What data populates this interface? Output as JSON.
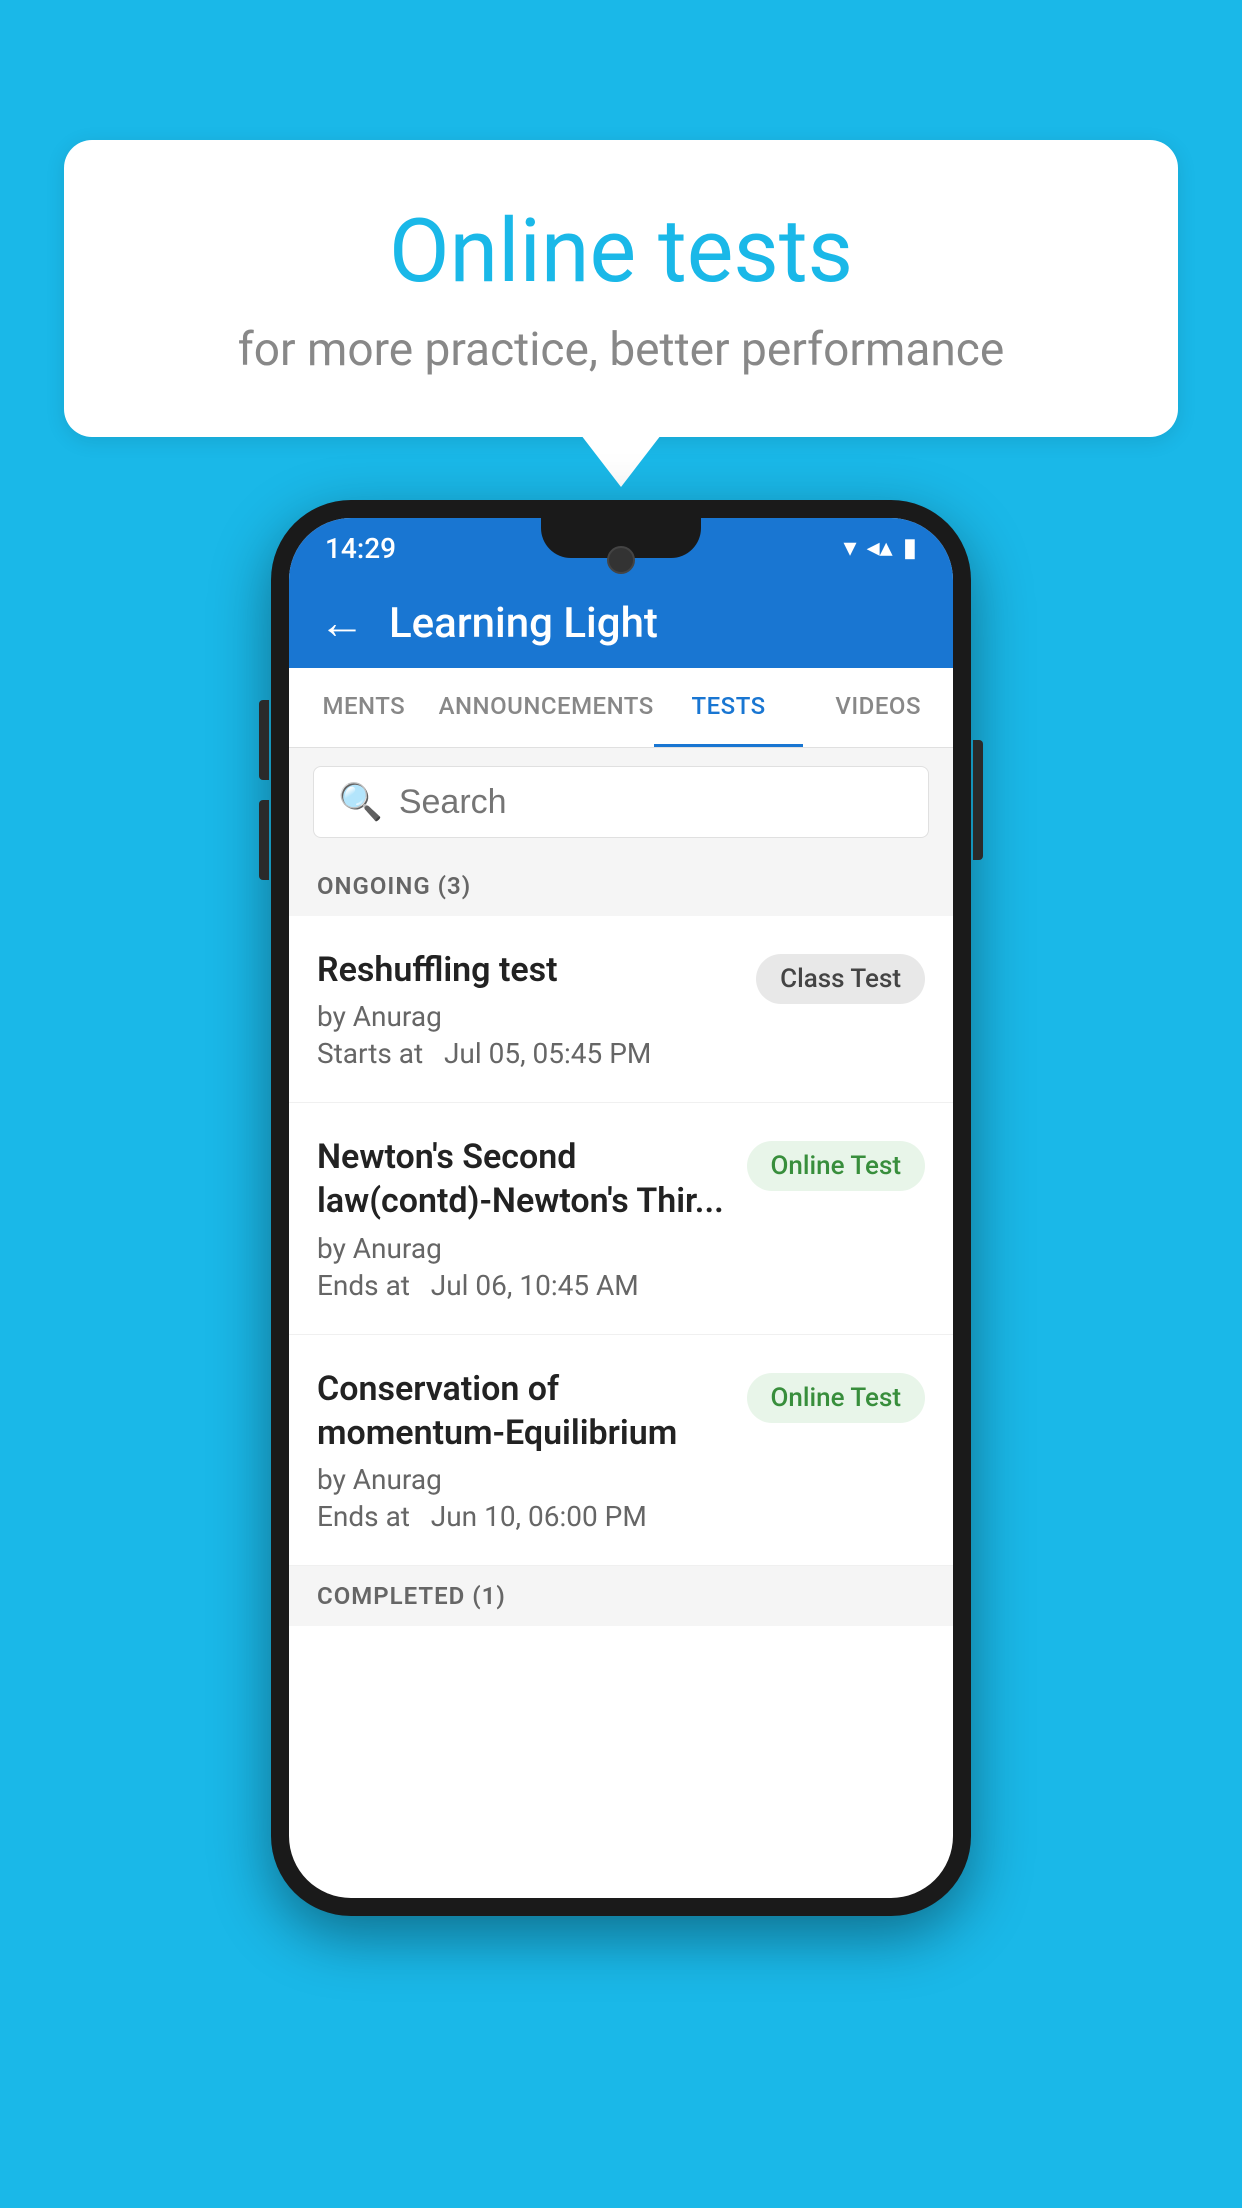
{
  "background_color": "#1ab8e8",
  "speech_bubble": {
    "title": "Online tests",
    "subtitle": "for more practice, better performance"
  },
  "phone": {
    "status_bar": {
      "time": "14:29",
      "wifi": "▾",
      "signal": "◂",
      "battery": "▮"
    },
    "header": {
      "back_label": "←",
      "title": "Learning Light"
    },
    "tabs": [
      {
        "label": "MENTS",
        "active": false
      },
      {
        "label": "ANNOUNCEMENTS",
        "active": false
      },
      {
        "label": "TESTS",
        "active": true
      },
      {
        "label": "VIDEOS",
        "active": false
      }
    ],
    "search": {
      "placeholder": "Search"
    },
    "ongoing_section": {
      "label": "ONGOING (3)"
    },
    "test_items": [
      {
        "name": "Reshuffling test",
        "author": "by Anurag",
        "time_label": "Starts at",
        "time_value": "Jul 05, 05:45 PM",
        "badge": "Class Test",
        "badge_type": "class"
      },
      {
        "name": "Newton's Second law(contd)-Newton's Thir...",
        "author": "by Anurag",
        "time_label": "Ends at",
        "time_value": "Jul 06, 10:45 AM",
        "badge": "Online Test",
        "badge_type": "online"
      },
      {
        "name": "Conservation of momentum-Equilibrium",
        "author": "by Anurag",
        "time_label": "Ends at",
        "time_value": "Jun 10, 06:00 PM",
        "badge": "Online Test",
        "badge_type": "online"
      }
    ],
    "completed_section": {
      "label": "COMPLETED (1)"
    }
  }
}
